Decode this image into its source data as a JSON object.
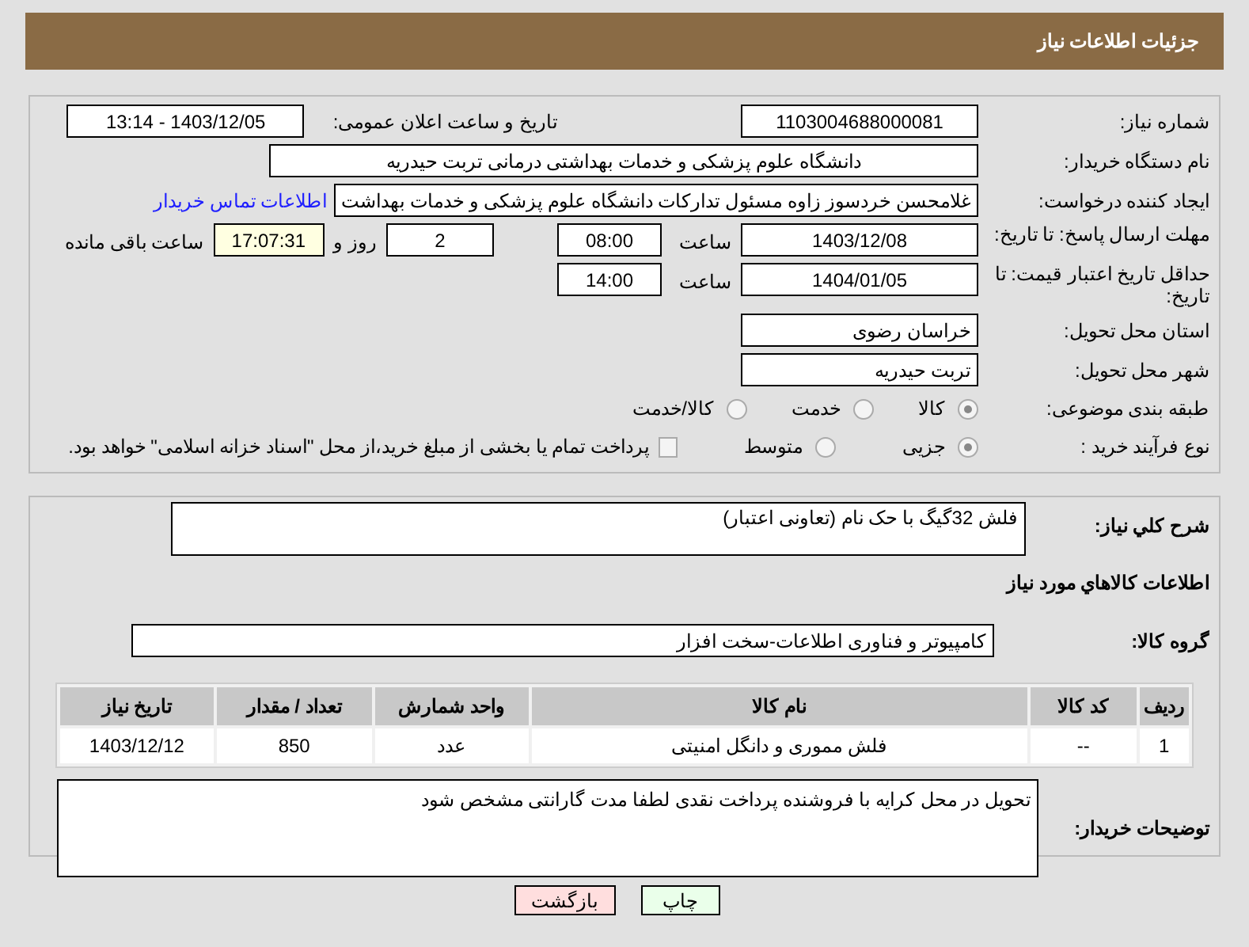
{
  "header": {
    "title": "جزئیات اطلاعات نیاز"
  },
  "need_number": {
    "label": "شماره نیاز:",
    "value": "1103004688000081"
  },
  "announce": {
    "label": "تاریخ و ساعت اعلان عمومی:",
    "value": "1403/12/05 - 13:14"
  },
  "buyer_org": {
    "label": "نام دستگاه خریدار:",
    "value": "دانشگاه علوم پزشکی و خدمات بهداشتی درمانی تربت حیدریه"
  },
  "requester": {
    "label": "ایجاد کننده درخواست:",
    "value": "غلامحسن خردسوز زاوه مسئول تدارکات دانشگاه علوم پزشکی و خدمات بهداشت",
    "link": "اطلاعات تماس خریدار"
  },
  "reply_deadline": {
    "label": "مهلت ارسال پاسخ: تا تاریخ:",
    "date": "1403/12/08",
    "time_label": "ساعت",
    "time": "08:00",
    "days": "2",
    "days_label": "روز و",
    "remaining": "17:07:31",
    "remaining_label": "ساعت باقی مانده"
  },
  "price_validity": {
    "label": "حداقل تاریخ اعتبار قیمت: تا تاریخ:",
    "date": "1404/01/05",
    "time_label": "ساعت",
    "time": "14:00"
  },
  "province": {
    "label": "استان محل تحویل:",
    "value": "خراسان رضوی"
  },
  "city": {
    "label": "شهر محل تحویل:",
    "value": "تربت حیدریه"
  },
  "category": {
    "label": "طبقه بندی موضوعی:",
    "options": [
      {
        "label": "کالا",
        "selected": true
      },
      {
        "label": "خدمت",
        "selected": false
      },
      {
        "label": "کالا/خدمت",
        "selected": false
      }
    ]
  },
  "process": {
    "label": "نوع فرآیند خرید :",
    "options": [
      {
        "label": "جزیی",
        "selected": true
      },
      {
        "label": "متوسط",
        "selected": false
      }
    ],
    "payment": {
      "checked": false,
      "text": "پرداخت تمام یا بخشی از مبلغ خرید،از محل \"اسناد خزانه اسلامی\" خواهد بود."
    }
  },
  "description": {
    "label": "شرح کلي نياز:",
    "value": "فلش 32گیگ با حک نام (تعاونی اعتبار)"
  },
  "goods_title": "اطلاعات كالاهاي مورد نياز",
  "goods_group": {
    "label": "گروه کالا:",
    "value": "کامپیوتر و فناوری اطلاعات-سخت افزار"
  },
  "table": {
    "columns": [
      "ردیف",
      "کد کالا",
      "نام کالا",
      "واحد شمارش",
      "تعداد / مقدار",
      "تاریخ نیاز"
    ],
    "rows": [
      [
        "1",
        "--",
        "فلش مموری و دانگل امنیتی",
        "عدد",
        "850",
        "1403/12/12"
      ]
    ]
  },
  "buyer_notes": {
    "label": "توضیحات خریدار:",
    "value": "تحویل در محل کرایه با فروشنده پرداخت نقدی لطفا مدت گارانتی مشخص شود"
  },
  "buttons": [
    {
      "label": "چاپ",
      "kind": "print"
    },
    {
      "label": "بازگشت",
      "kind": "back"
    }
  ]
}
